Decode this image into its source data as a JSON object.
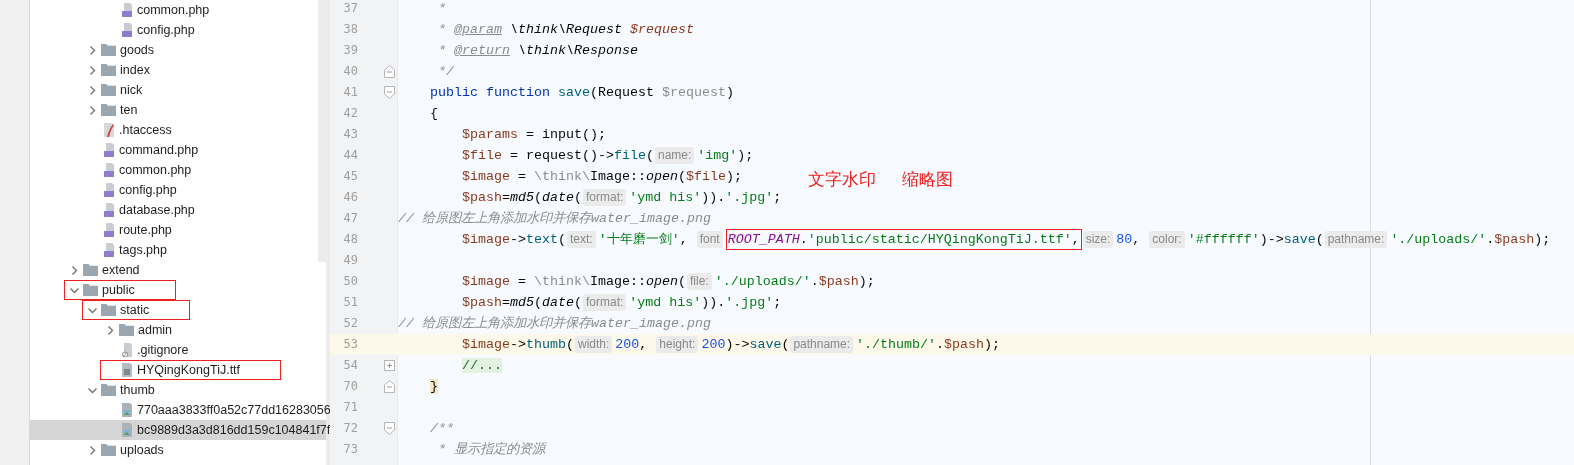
{
  "tree": {
    "items": [
      {
        "children": [
          {
            "children": [
              {
                "name": "common.php",
                "kind": "php",
                "selected": false
              },
              {
                "name": "config.php",
                "kind": "php",
                "selected": false
              }
            ]
          },
          {
            "name": "goods",
            "kind": "folder",
            "expanded": false,
            "selected": false
          },
          {
            "name": "index",
            "kind": "folder",
            "expanded": false,
            "selected": false
          },
          {
            "name": "nick",
            "kind": "folder",
            "expanded": false,
            "selected": false
          },
          {
            "name": "ten",
            "kind": "folder",
            "expanded": false,
            "selected": false
          },
          {
            "name": ".htaccess",
            "kind": "htaccess",
            "selected": false
          },
          {
            "name": "command.php",
            "kind": "php",
            "selected": false
          },
          {
            "name": "common.php",
            "kind": "php",
            "selected": false
          },
          {
            "name": "config.php",
            "kind": "php",
            "selected": false
          },
          {
            "name": "database.php",
            "kind": "php",
            "selected": false
          },
          {
            "name": "route.php",
            "kind": "php",
            "selected": false
          },
          {
            "name": "tags.php",
            "kind": "php",
            "selected": false
          }
        ]
      },
      {
        "name": "extend",
        "kind": "folder",
        "expanded": false,
        "selected": false
      },
      {
        "name": "public",
        "kind": "folder",
        "expanded": true,
        "selected": false,
        "highlighted": true,
        "children": [
          {
            "name": "static",
            "kind": "folder",
            "expanded": true,
            "selected": false,
            "highlighted": true,
            "children": [
              {
                "name": "admin",
                "kind": "folder",
                "expanded": false,
                "selected": false
              },
              {
                "name": ".gitignore",
                "kind": "gitignore",
                "selected": false
              },
              {
                "name": "HYQingKongTiJ.ttf",
                "kind": "text",
                "selected": false,
                "highlighted": true
              }
            ]
          },
          {
            "name": "thumb",
            "kind": "folder",
            "expanded": true,
            "selected": false,
            "children": [
              {
                "name": "770aaa3833ff0a52c77dd16283056",
                "kind": "image",
                "selected": false
              },
              {
                "name": "bc9889d3a3d816dd159c104841f7f",
                "kind": "image",
                "selected": true
              }
            ]
          },
          {
            "name": "uploads",
            "kind": "folder",
            "expanded": false,
            "selected": false
          }
        ]
      }
    ]
  },
  "editor": {
    "lines": [
      {
        "number": "37",
        "kind": "doc",
        "segments": [
          {
            "kind": "code",
            "tokens": [
              {
                "kind": "c",
                "text": "*"
              }
            ]
          }
        ]
      },
      {
        "number": "38",
        "kind": "doc",
        "segments": [
          {
            "kind": "code",
            "tokens": [
              {
                "kind": "c",
                "text": "* "
              },
              {
                "kind": "dt",
                "text": "@param"
              },
              {
                "kind": "d",
                "text": " \\think\\Request "
              },
              {
                "kind": "dv",
                "text": "$request"
              }
            ]
          }
        ]
      },
      {
        "number": "39",
        "kind": "doc",
        "segments": [
          {
            "kind": "code",
            "tokens": [
              {
                "kind": "c",
                "text": "* "
              },
              {
                "kind": "dt",
                "text": "@return"
              },
              {
                "kind": "d",
                "text": " \\think\\Response"
              }
            ]
          }
        ]
      },
      {
        "number": "40",
        "kind": "doc",
        "fold_end": true,
        "segments": [
          {
            "kind": "code",
            "tokens": [
              {
                "kind": "c",
                "text": "*/"
              }
            ]
          }
        ]
      },
      {
        "number": "41",
        "kind": "method",
        "fold_start": true,
        "segments": [
          {
            "kind": "code",
            "tokens": [
              {
                "kind": "k",
                "text": "public function "
              },
              {
                "kind": "f",
                "text": "save"
              },
              {
                "kind": "p",
                "text": "(Request "
              },
              {
                "kind": "u",
                "text": "$request"
              },
              {
                "kind": "p",
                "text": ")"
              }
            ]
          }
        ]
      },
      {
        "number": "42",
        "kind": "method",
        "segments": [
          {
            "kind": "code",
            "tokens": [
              {
                "kind": "p",
                "text": "{"
              }
            ]
          }
        ]
      },
      {
        "number": "43",
        "kind": "body",
        "segments": [
          {
            "kind": "code",
            "tokens": [
              {
                "kind": "v",
                "text": "$params"
              },
              {
                "kind": "p",
                "text": " = input();"
              }
            ]
          }
        ]
      },
      {
        "number": "44",
        "kind": "body",
        "segments": [
          {
            "kind": "code",
            "tokens": [
              {
                "kind": "v",
                "text": "$file"
              },
              {
                "kind": "p",
                "text": " = request()->"
              },
              {
                "kind": "f",
                "text": "file"
              },
              {
                "kind": "p",
                "text": "("
              }
            ]
          },
          {
            "kind": "hint",
            "text": "name:"
          },
          {
            "kind": "code",
            "tokens": [
              {
                "kind": "s",
                "text": "'img'"
              },
              {
                "kind": "p",
                "text": ");"
              }
            ]
          }
        ]
      },
      {
        "number": "45",
        "kind": "body",
        "segments": [
          {
            "kind": "code",
            "tokens": [
              {
                "kind": "v",
                "text": "$image"
              },
              {
                "kind": "p",
                "text": " = "
              },
              {
                "kind": "g",
                "text": "\\think\\"
              },
              {
                "kind": "p",
                "text": "Image::"
              },
              {
                "kind": "i",
                "text": "open"
              },
              {
                "kind": "p",
                "text": "("
              },
              {
                "kind": "v",
                "text": "$file"
              },
              {
                "kind": "p",
                "text": ");"
              }
            ]
          }
        ]
      },
      {
        "number": "46",
        "kind": "body",
        "segments": [
          {
            "kind": "code",
            "tokens": [
              {
                "kind": "v",
                "text": "$pash"
              },
              {
                "kind": "p",
                "text": "="
              },
              {
                "kind": "i",
                "text": "md5"
              },
              {
                "kind": "p",
                "text": "("
              },
              {
                "kind": "i",
                "text": "date"
              },
              {
                "kind": "p",
                "text": "("
              }
            ]
          },
          {
            "kind": "hint",
            "text": "format:"
          },
          {
            "kind": "code",
            "tokens": [
              {
                "kind": "s",
                "text": "'ymd his'"
              },
              {
                "kind": "p",
                "text": "))."
              },
              {
                "kind": "s",
                "text": "'.jpg'"
              },
              {
                "kind": "p",
                "text": ";"
              }
            ]
          }
        ]
      },
      {
        "number": "47",
        "kind": "top",
        "segments": [
          {
            "kind": "code",
            "tokens": [
              {
                "kind": "c",
                "text": "// 给原图左上角添加水印并保存water_image.png"
              }
            ]
          }
        ]
      },
      {
        "number": "48",
        "kind": "body",
        "segments": [
          {
            "kind": "code",
            "tokens": [
              {
                "kind": "v",
                "text": "$image"
              },
              {
                "kind": "p",
                "text": "->"
              },
              {
                "kind": "f",
                "text": "text"
              },
              {
                "kind": "p",
                "text": "("
              }
            ]
          },
          {
            "kind": "hint",
            "text": "text:"
          },
          {
            "kind": "code",
            "tokens": [
              {
                "kind": "s",
                "text": "'十年磨一剑'"
              },
              {
                "kind": "p",
                "text": ", "
              }
            ]
          },
          {
            "kind": "hint",
            "text": "font"
          },
          {
            "kind": "code",
            "boxed": true,
            "tokens": [
              {
                "kind": "ic",
                "text": "ROOT_PATH"
              },
              {
                "kind": "p",
                "text": "."
              },
              {
                "kind": "s",
                "text": "'public/static/HYQingKongTiJ.ttf'"
              },
              {
                "kind": "p",
                "text": ","
              }
            ]
          },
          {
            "kind": "hint",
            "text": "size:"
          },
          {
            "kind": "code",
            "tokens": [
              {
                "kind": "n",
                "text": "80"
              },
              {
                "kind": "p",
                "text": ", "
              }
            ]
          },
          {
            "kind": "hint",
            "text": "color:"
          },
          {
            "kind": "code",
            "tokens": [
              {
                "kind": "s",
                "text": "'#ffffff'"
              },
              {
                "kind": "p",
                "text": ")->"
              },
              {
                "kind": "f",
                "text": "save"
              },
              {
                "kind": "p",
                "text": "("
              }
            ]
          },
          {
            "kind": "hint",
            "text": "pathname:"
          },
          {
            "kind": "code",
            "tokens": [
              {
                "kind": "s",
                "text": "'./uploads/'"
              },
              {
                "kind": "p",
                "text": "."
              },
              {
                "kind": "v",
                "text": "$pash"
              },
              {
                "kind": "p",
                "text": ");"
              }
            ]
          }
        ]
      },
      {
        "number": "49",
        "kind": "top"
      },
      {
        "number": "50",
        "kind": "body",
        "segments": [
          {
            "kind": "code",
            "tokens": [
              {
                "kind": "v",
                "text": "$image"
              },
              {
                "kind": "p",
                "text": " = "
              },
              {
                "kind": "g",
                "text": "\\think\\"
              },
              {
                "kind": "p",
                "text": "Image::"
              },
              {
                "kind": "i",
                "text": "open"
              },
              {
                "kind": "p",
                "text": "("
              }
            ]
          },
          {
            "kind": "hint",
            "text": "file:"
          },
          {
            "kind": "code",
            "tokens": [
              {
                "kind": "s",
                "text": "'./uploads/'"
              },
              {
                "kind": "p",
                "text": "."
              },
              {
                "kind": "v",
                "text": "$pash"
              },
              {
                "kind": "p",
                "text": ");"
              }
            ]
          }
        ]
      },
      {
        "number": "51",
        "kind": "body",
        "segments": [
          {
            "kind": "code",
            "tokens": [
              {
                "kind": "v",
                "text": "$pash"
              },
              {
                "kind": "p",
                "text": "="
              },
              {
                "kind": "i",
                "text": "md5"
              },
              {
                "kind": "p",
                "text": "("
              },
              {
                "kind": "i",
                "text": "date"
              },
              {
                "kind": "p",
                "text": "("
              }
            ]
          },
          {
            "kind": "hint",
            "text": "format:"
          },
          {
            "kind": "code",
            "tokens": [
              {
                "kind": "s",
                "text": "'ymd his'"
              },
              {
                "kind": "p",
                "text": "))."
              },
              {
                "kind": "s",
                "text": "'.jpg'"
              },
              {
                "kind": "p",
                "text": ";"
              }
            ]
          }
        ]
      },
      {
        "number": "52",
        "kind": "top",
        "segments": [
          {
            "kind": "code",
            "tokens": [
              {
                "kind": "c",
                "text": "// 给原图左上角添加水印并保存water_image.png"
              }
            ]
          }
        ]
      },
      {
        "number": "53",
        "kind": "body",
        "current": true,
        "segments": [
          {
            "kind": "code",
            "tokens": [
              {
                "kind": "v",
                "text": "$image"
              },
              {
                "kind": "p",
                "text": "->"
              },
              {
                "kind": "f",
                "text": "thumb"
              },
              {
                "kind": "p",
                "text": "("
              }
            ]
          },
          {
            "kind": "hint",
            "text": "width:"
          },
          {
            "kind": "code",
            "tokens": [
              {
                "kind": "n",
                "text": "200"
              },
              {
                "kind": "p",
                "text": ", "
              }
            ]
          },
          {
            "kind": "hint",
            "text": "height:"
          },
          {
            "kind": "code",
            "tokens": [
              {
                "kind": "n",
                "text": "200"
              },
              {
                "kind": "p",
                "text": ")->"
              },
              {
                "kind": "f",
                "text": "save"
              },
              {
                "kind": "p",
                "text": "("
              }
            ]
          },
          {
            "kind": "hint",
            "text": "pathname:"
          },
          {
            "kind": "code",
            "tokens": [
              {
                "kind": "s",
                "text": "'./thumb/'"
              },
              {
                "kind": "p",
                "text": "."
              },
              {
                "kind": "v",
                "text": "$pash"
              },
              {
                "kind": "p",
                "text": ");"
              }
            ]
          }
        ]
      },
      {
        "number": "54",
        "kind": "body",
        "collapsed": true,
        "segments": [
          {
            "kind": "code",
            "tokens": [
              {
                "kind": "fp",
                "text": "//..."
              }
            ]
          }
        ]
      },
      {
        "number": "70",
        "kind": "method",
        "fold_end": true,
        "segments": [
          {
            "kind": "code",
            "tokens": [
              {
                "kind": "bm",
                "text": "}"
              }
            ]
          }
        ]
      },
      {
        "number": "71",
        "kind": "top"
      },
      {
        "number": "72",
        "kind": "method",
        "fold_start": true,
        "segments": [
          {
            "kind": "code",
            "tokens": [
              {
                "kind": "c",
                "text": "/**"
              }
            ]
          }
        ]
      },
      {
        "number": "73",
        "kind": "doc",
        "segments": [
          {
            "kind": "code",
            "tokens": [
              {
                "kind": "c",
                "text": "* 显示指定的资源"
              }
            ]
          }
        ]
      }
    ]
  },
  "annotations": [
    {
      "text": "文字水印"
    },
    {
      "text": "缩略图"
    }
  ]
}
